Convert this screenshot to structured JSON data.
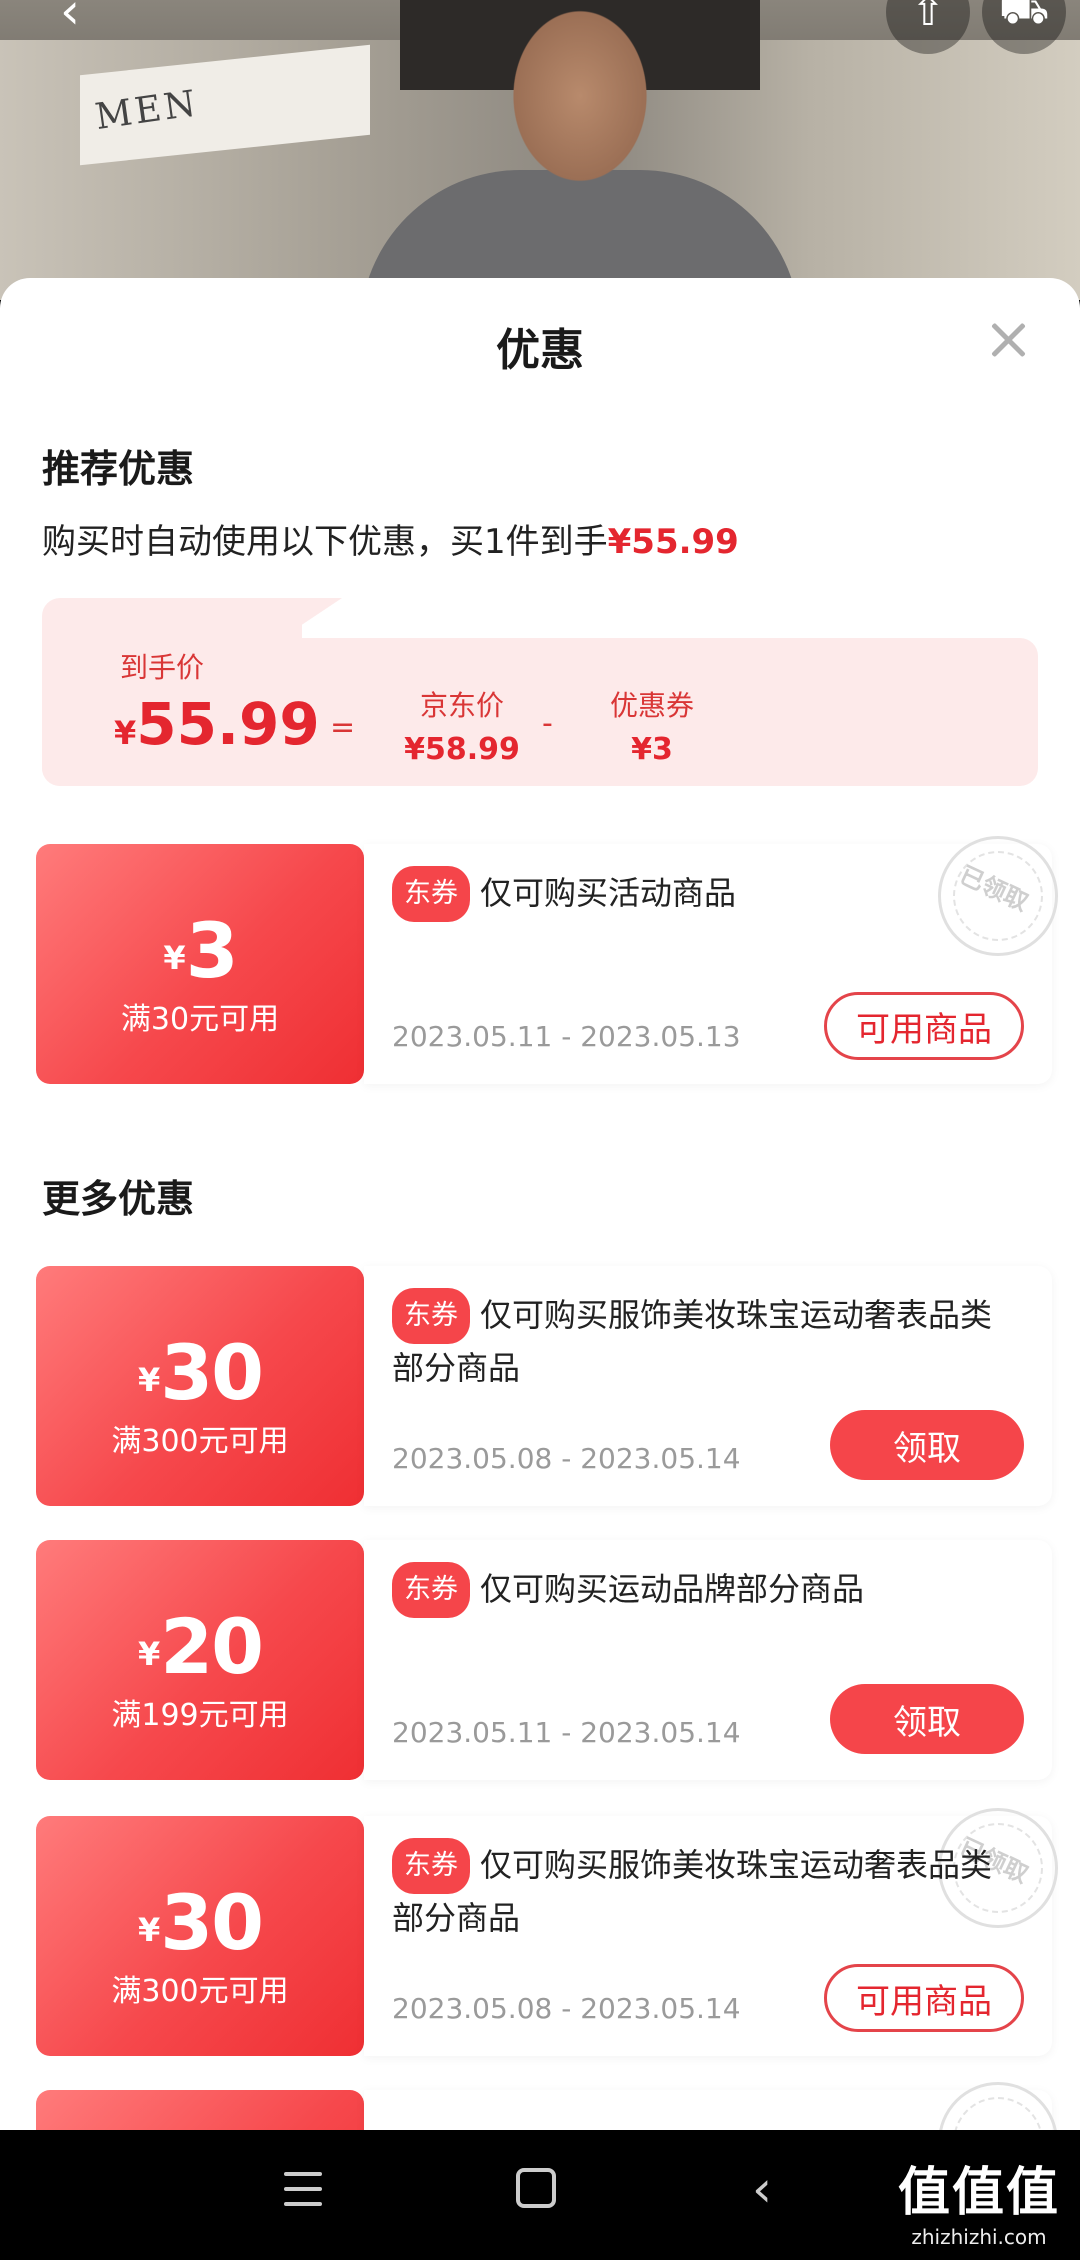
{
  "sheet": {
    "title": "优惠",
    "recommended_heading": "推荐优惠",
    "auto_use_text": "购买时自动使用以下优惠，买1件到手",
    "auto_use_price": "¥55.99",
    "more_heading": "更多优惠"
  },
  "summary": {
    "final_label": "到手价",
    "final_yen": "¥",
    "final_price": "55.99",
    "equals": "=",
    "jd_label": "京东价",
    "jd_price": "¥58.99",
    "minus": "-",
    "coupon_label": "优惠券",
    "coupon_value": "¥3"
  },
  "coupons": [
    {
      "yen": "¥",
      "amount": "3",
      "condition": "满30元可用",
      "tag": "东券",
      "desc": "仅可购买活动商品",
      "date": "2023.05.11 - 2023.05.13",
      "button": "可用商品",
      "stamp": "已领取"
    },
    {
      "yen": "¥",
      "amount": "30",
      "condition": "满300元可用",
      "tag": "东券",
      "desc": "仅可购买服饰美妆珠宝运动奢表品类部分商品",
      "date": "2023.05.08 - 2023.05.14",
      "button": "领取"
    },
    {
      "yen": "¥",
      "amount": "20",
      "condition": "满199元可用",
      "tag": "东券",
      "desc": "仅可购买运动品牌部分商品",
      "date": "2023.05.11 - 2023.05.14",
      "button": "领取"
    },
    {
      "yen": "¥",
      "amount": "30",
      "condition": "满300元可用",
      "tag": "东券",
      "desc": "仅可购买服饰美妆珠宝运动奢表品类部分商品",
      "date": "2023.05.08 - 2023.05.14",
      "button": "可用商品",
      "stamp": "已领取"
    }
  ],
  "hero": {
    "store_sign": "MEN"
  },
  "watermark": {
    "main": "值值值",
    "sub": "zhizhizhi.com"
  },
  "colors": {
    "accent": "#e4262f",
    "coupon_red": "#f5454a",
    "summary_bg": "#fdeaea"
  }
}
